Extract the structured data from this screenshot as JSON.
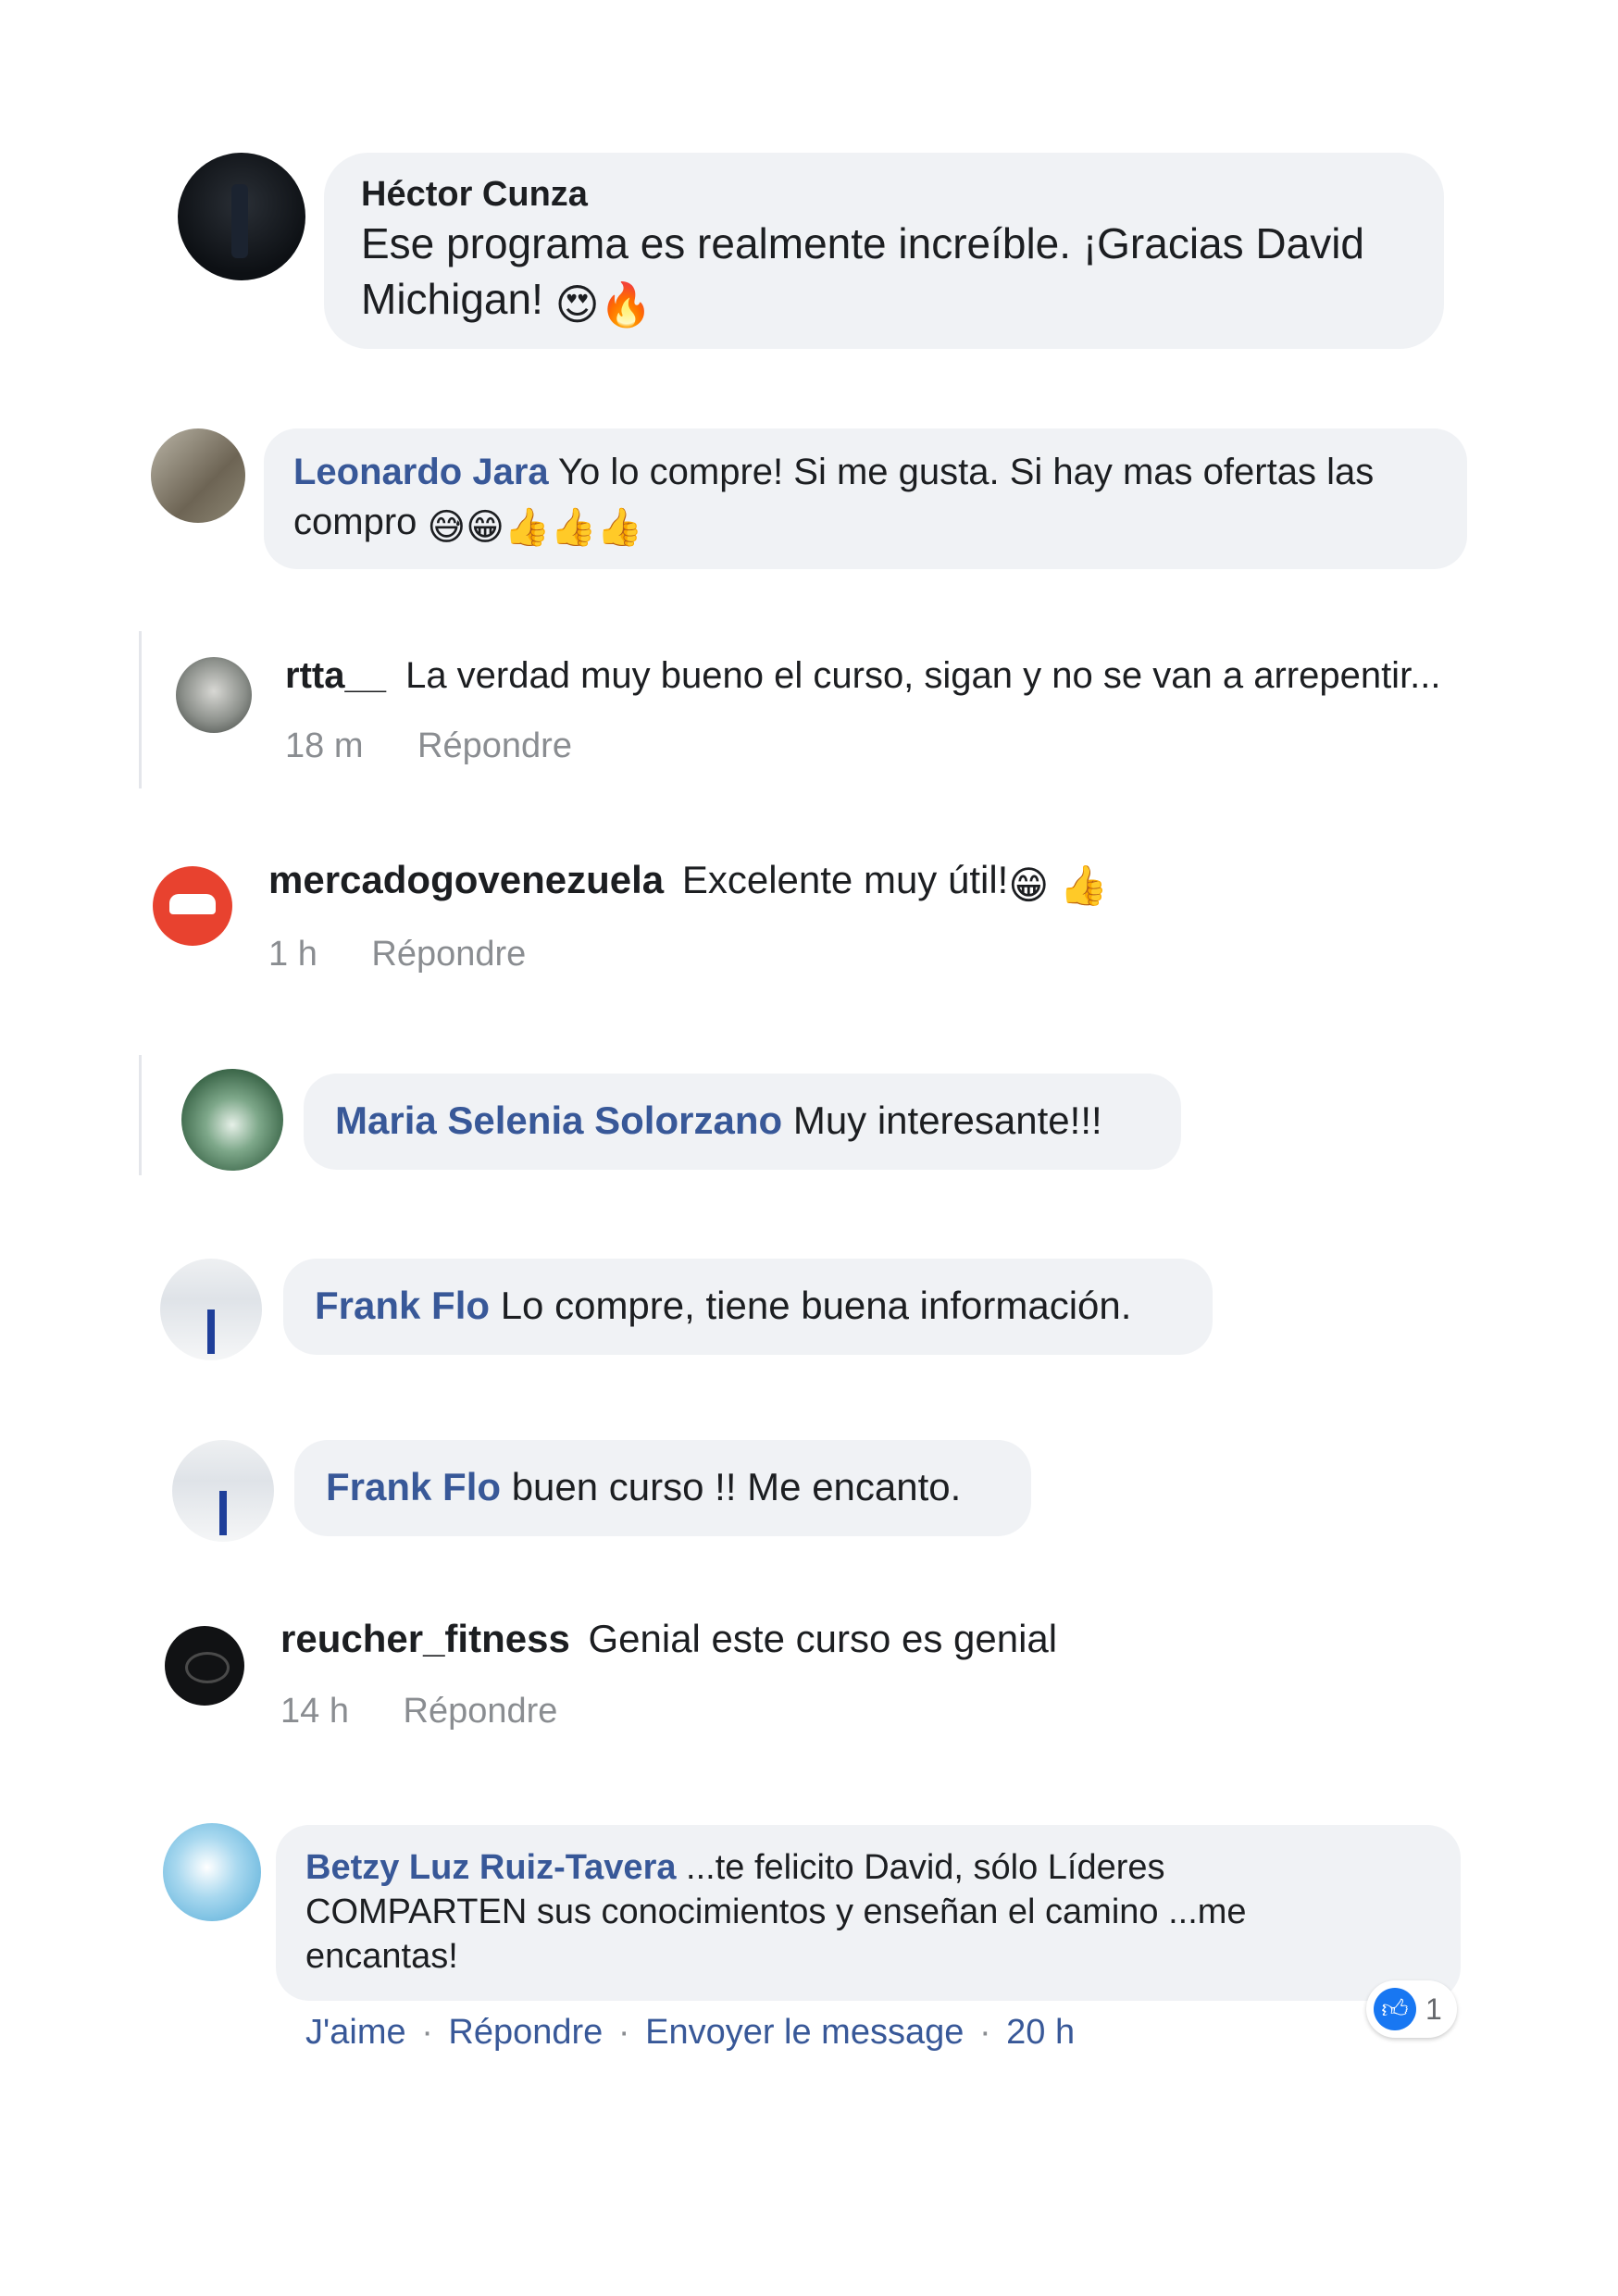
{
  "comments": [
    {
      "author": "Héctor Cunza",
      "text": "Ese programa es realmente increíble. ¡Gracias David Michigan! 😍🔥",
      "text_line1": "Ese programa es realmente increíble. ¡Gracias David",
      "text_line2": "Michigan!",
      "emojis": "😍🔥"
    },
    {
      "author": "Leonardo Jara",
      "text_line1": "Yo lo compre! Si me gusta. Si hay mas ofertas las",
      "text_line2": "compro",
      "emojis": "😅😁👍👍👍"
    },
    {
      "author": "rtta__",
      "text": "La verdad muy bueno el curso, sigan y no se van a arrepentir...",
      "time": "18 m",
      "reply": "Répondre"
    },
    {
      "author": "mercadogovenezuela",
      "text": "Excelente muy útil!",
      "emojis": "😁 👍",
      "time": "1 h",
      "reply": "Répondre"
    },
    {
      "author": "Maria Selenia Solorzano",
      "text": "Muy interesante!!!"
    },
    {
      "author": "Frank Flo",
      "text": "Lo compre, tiene buena información."
    },
    {
      "author": "Frank Flo",
      "text": "buen curso !! Me encanto."
    },
    {
      "author": "reucher_fitness",
      "text": "Genial este curso es genial",
      "time": "14 h",
      "reply": "Répondre"
    },
    {
      "author": "Betzy Luz Ruiz-Tavera",
      "text_line1": "...te felicito David, sólo Líderes",
      "text_line2": "COMPARTEN sus conocimientos y enseñan el camino ...me",
      "text_line3": "encantas!",
      "like": "J'aime",
      "reply": "Répondre",
      "message": "Envoyer le message",
      "time": "20 h",
      "reaction_count": "1"
    }
  ],
  "separator": "·",
  "colors": {
    "bubble": "#f0f2f5",
    "name_blue": "#385898",
    "meta": "#8a8d91",
    "like_blue": "#1877f2"
  }
}
